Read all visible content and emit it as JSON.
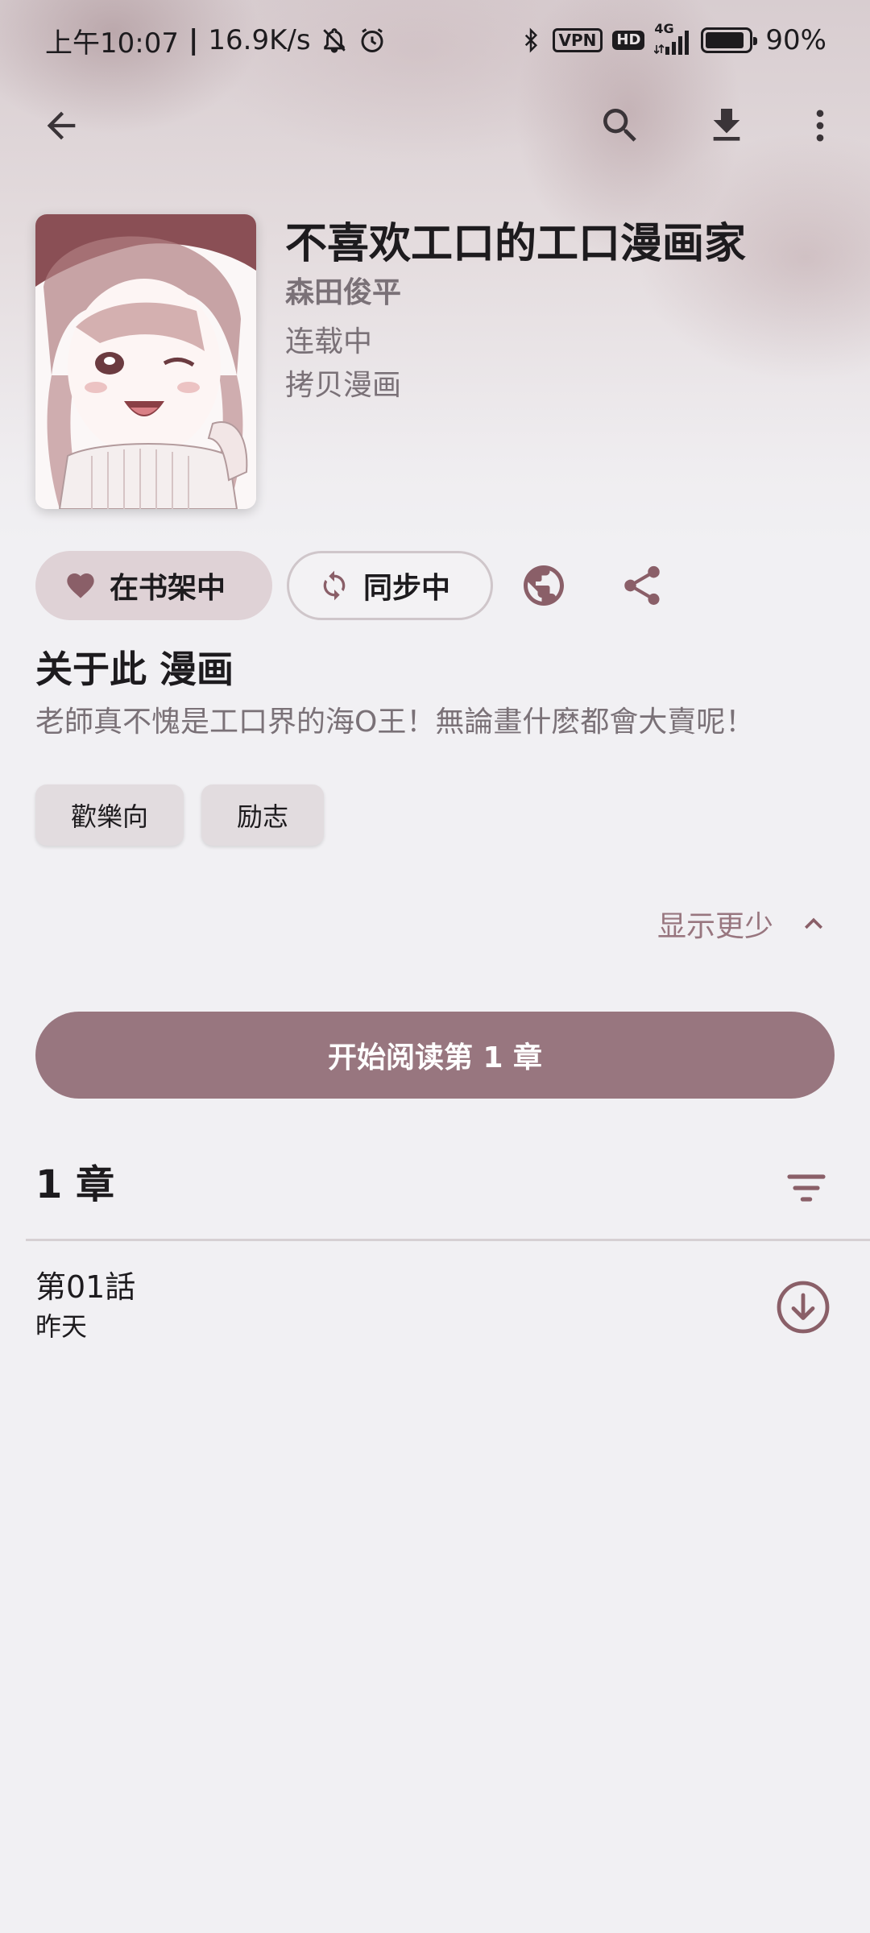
{
  "status_bar": {
    "time": "上午10:07",
    "speed": "16.9K/s",
    "vpn": "VPN",
    "hd": "HD",
    "network": "4G",
    "battery": "90%",
    "battery_level": 0.9
  },
  "toolbar": {
    "back_icon": "arrow-back-icon",
    "search_icon": "search-icon",
    "download_icon": "download-icon",
    "more_icon": "more-vert-icon"
  },
  "manga": {
    "title": "不喜欢工口的工口漫画家",
    "author": "森田俊平",
    "status": "连载中",
    "source": "拷贝漫画"
  },
  "actions": {
    "library_label": "在书架中",
    "sync_label": "同步中",
    "web_icon": "globe-icon",
    "share_icon": "share-icon"
  },
  "about": {
    "heading": "关于此 漫画",
    "description": "老師真不愧是工口界的海O王！無論畫什麽都會大賣呢！",
    "tags": [
      "歡樂向",
      "励志"
    ],
    "show_less": "显示更少"
  },
  "start_button": "开始阅读第 1 章",
  "chapters": {
    "count_label": "1 章",
    "items": [
      {
        "name": "第01話",
        "date": "昨天"
      }
    ]
  },
  "colors": {
    "accent": "#98767f",
    "chip_active": "#dfd2d6",
    "background": "#f1f0f3"
  }
}
